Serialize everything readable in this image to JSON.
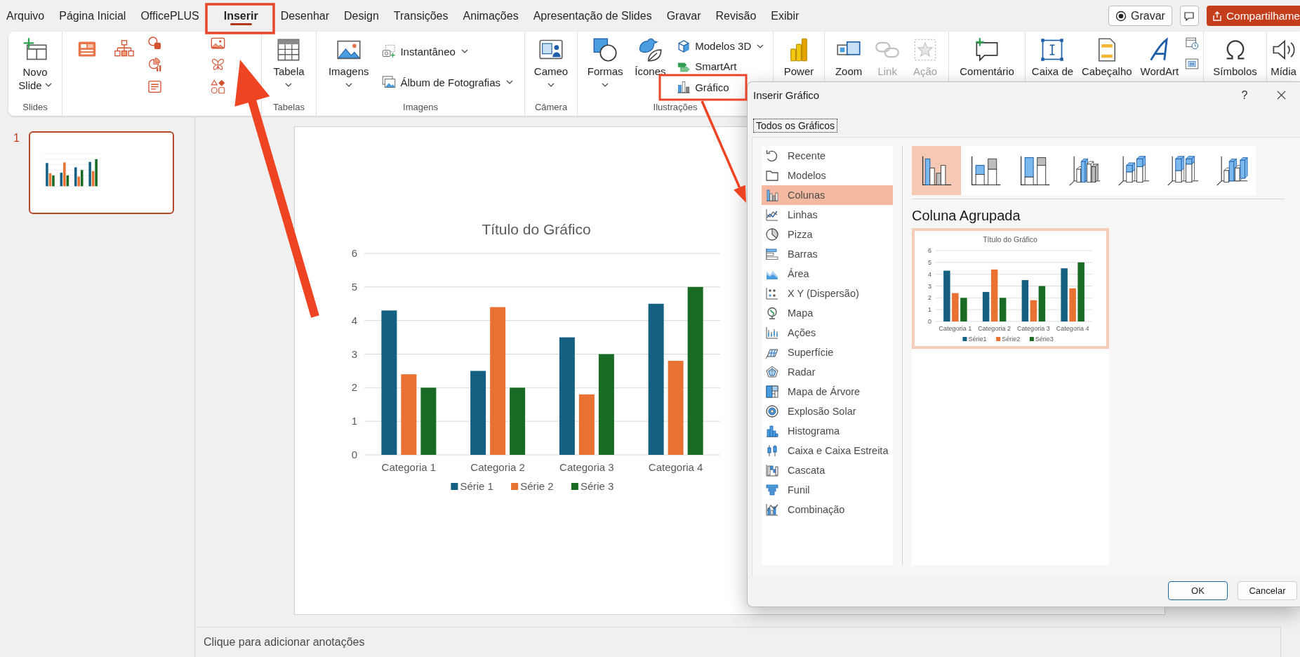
{
  "menu_tabs": [
    {
      "label": "Arquivo",
      "selected": false
    },
    {
      "label": "Página Inicial",
      "selected": false
    },
    {
      "label": "OfficePLUS",
      "selected": false
    },
    {
      "label": "Inserir",
      "selected": true
    },
    {
      "label": "Desenhar",
      "selected": false
    },
    {
      "label": "Design",
      "selected": false
    },
    {
      "label": "Transições",
      "selected": false
    },
    {
      "label": "Animações",
      "selected": false
    },
    {
      "label": "Apresentação de Slides",
      "selected": false
    },
    {
      "label": "Gravar",
      "selected": false
    },
    {
      "label": "Revisão",
      "selected": false
    },
    {
      "label": "Exibir",
      "selected": false
    }
  ],
  "record_button": {
    "label": "Gravar"
  },
  "share_button": {
    "label": "Compartilhame"
  },
  "ribbon": [
    {
      "label": "Slides",
      "columns": [
        [
          {
            "kind": "large-wrap",
            "label": "Novo Slide",
            "dropdown": true,
            "disabled": false
          }
        ]
      ]
    },
    {
      "columns": [
        [
          {
            "kind": "icon-grid"
          }
        ]
      ]
    },
    {
      "label": "Tabelas",
      "columns": [
        [
          {
            "kind": "large",
            "label": "Tabela",
            "dropdown": true,
            "disabled": false
          }
        ]
      ]
    },
    {
      "label": "Imagens",
      "columns": [
        [
          {
            "kind": "large",
            "label": "Imagens",
            "dropdown": true,
            "disabled": false
          }
        ],
        [
          {
            "kind": "small",
            "label": "Instantâneo",
            "dropdown": true,
            "disabled": false
          },
          {
            "kind": "small",
            "label": "Álbum de Fotografias",
            "dropdown": true,
            "disabled": false
          }
        ]
      ]
    },
    {
      "label": "Câmera",
      "columns": [
        [
          {
            "kind": "large",
            "label": "Cameo",
            "dropdown": true,
            "disabled": false
          }
        ]
      ]
    },
    {
      "label": "Ilustrações",
      "columns": [
        [
          {
            "kind": "large",
            "label": "Formas",
            "dropdown": true,
            "disabled": false
          }
        ],
        [
          {
            "kind": "large",
            "label": "Ícones",
            "dropdown": false,
            "disabled": false
          }
        ],
        [
          {
            "kind": "small",
            "label": "Modelos 3D",
            "dropdown": true,
            "disabled": false
          },
          {
            "kind": "small",
            "label": "SmartArt",
            "dropdown": false,
            "disabled": false
          },
          {
            "kind": "small",
            "label": "Gráfico",
            "dropdown": false,
            "disabled": false
          }
        ]
      ]
    },
    {
      "columns": [
        [
          {
            "kind": "large",
            "label": "Power",
            "dropdown": false,
            "disabled": false
          }
        ]
      ]
    },
    {
      "columns": [
        [
          {
            "kind": "large",
            "label": "Zoom",
            "dropdown": false,
            "disabled": false
          }
        ],
        [
          {
            "kind": "large",
            "label": "Link",
            "dropdown": false,
            "disabled": true
          }
        ],
        [
          {
            "kind": "large",
            "label": "Ação",
            "dropdown": false,
            "disabled": true
          }
        ]
      ]
    },
    {
      "columns": [
        [
          {
            "kind": "large",
            "label": "Comentário",
            "dropdown": false,
            "disabled": false
          }
        ]
      ]
    },
    {
      "columns": [
        [
          {
            "kind": "large",
            "label": "Caixa de",
            "dropdown": false,
            "disabled": false
          }
        ],
        [
          {
            "kind": "large",
            "label": "Cabeçalho",
            "dropdown": false,
            "disabled": false
          }
        ],
        [
          {
            "kind": "large",
            "label": "WordArt",
            "dropdown": false,
            "disabled": false
          }
        ],
        [
          {
            "kind": "mini-icons"
          }
        ]
      ]
    },
    {
      "columns": [
        [
          {
            "kind": "large",
            "label": "Símbolos",
            "dropdown": false,
            "disabled": false
          }
        ]
      ]
    },
    {
      "columns": [
        [
          {
            "kind": "large",
            "label": "Mídia",
            "dropdown": false,
            "disabled": false
          }
        ]
      ]
    }
  ],
  "slides": [
    {
      "number": "1",
      "selected": true
    }
  ],
  "slide": {
    "chart_data": {
      "type": "bar",
      "orientation": "vertical",
      "title": "Título do Gráfico",
      "categories": [
        "Categoria 1",
        "Categoria 2",
        "Categoria 3",
        "Categoria 4"
      ],
      "series": [
        {
          "name": "Série 1",
          "color": "#156082",
          "values": [
            4.3,
            2.5,
            3.5,
            4.5
          ]
        },
        {
          "name": "Série 2",
          "color": "#e97132",
          "values": [
            2.4,
            4.4,
            1.8,
            2.8
          ]
        },
        {
          "name": "Série 3",
          "color": "#196b24",
          "values": [
            2,
            2,
            3,
            5
          ]
        }
      ],
      "ylim": [
        0,
        6
      ],
      "yticks": [
        0,
        1,
        2,
        3,
        4,
        5,
        6
      ],
      "grid": true,
      "legend": "bottom"
    }
  },
  "notes": {
    "placeholder": "Clique para adicionar anotações"
  },
  "dialog": {
    "title": "Inserir Gráfico",
    "help": "?",
    "tabs": [
      {
        "label": "Todos os Gráficos",
        "selected": true
      }
    ],
    "categories": [
      {
        "label": "Recente",
        "selected": false
      },
      {
        "label": "Modelos",
        "selected": false
      },
      {
        "label": "Colunas",
        "selected": true
      },
      {
        "label": "Linhas",
        "selected": false
      },
      {
        "label": "Pizza",
        "selected": false
      },
      {
        "label": "Barras",
        "selected": false
      },
      {
        "label": "Área",
        "selected": false
      },
      {
        "label": "X Y (Dispersão)",
        "selected": false
      },
      {
        "label": "Mapa",
        "selected": false
      },
      {
        "label": "Ações",
        "selected": false
      },
      {
        "label": "Superfície",
        "selected": false
      },
      {
        "label": "Radar",
        "selected": false
      },
      {
        "label": "Mapa de Árvore",
        "selected": false
      },
      {
        "label": "Explosão Solar",
        "selected": false
      },
      {
        "label": "Histograma",
        "selected": false
      },
      {
        "label": "Caixa e Caixa Estreita",
        "selected": false
      },
      {
        "label": "Cascata",
        "selected": false
      },
      {
        "label": "Funil",
        "selected": false
      },
      {
        "label": "Combinação",
        "selected": false
      }
    ],
    "subtypes": [
      {
        "selected": true
      },
      {
        "selected": false
      },
      {
        "selected": false
      },
      {
        "selected": false
      },
      {
        "selected": false
      },
      {
        "selected": false
      },
      {
        "selected": false
      }
    ],
    "subtype_name": "Coluna Agrupada",
    "preview": {
      "chart_data": {
        "type": "bar",
        "orientation": "vertical",
        "title": "Título do Gráfico",
        "categories": [
          "Categoria 1",
          "Categoria 2",
          "Categoria 3",
          "Categoria 4"
        ],
        "series": [
          {
            "name": "Série1",
            "color": "#156082",
            "values": [
              4.3,
              2.5,
              3.5,
              4.5
            ]
          },
          {
            "name": "Série2",
            "color": "#e97132",
            "values": [
              2.4,
              4.4,
              1.8,
              2.8
            ]
          },
          {
            "name": "Série3",
            "color": "#196b24",
            "values": [
              2,
              2,
              3,
              5
            ]
          }
        ],
        "ylim": [
          0,
          6
        ],
        "yticks": [
          0,
          1,
          2,
          3,
          4,
          5,
          6
        ],
        "grid": true,
        "legend": "bottom"
      }
    },
    "buttons": [
      {
        "label": "OK",
        "default": true
      },
      {
        "label": "Cancelar",
        "default": false
      }
    ]
  }
}
